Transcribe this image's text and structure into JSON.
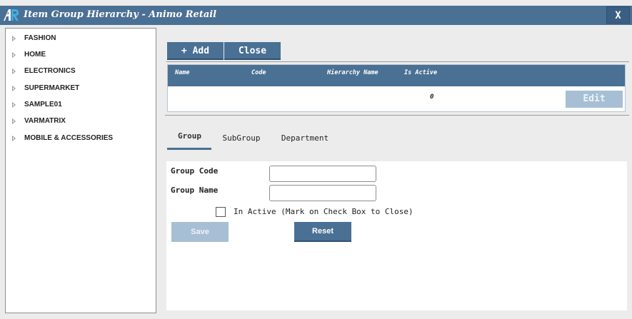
{
  "window": {
    "title": "Item Group Hierarchy - Animo Retail",
    "close_label": "X",
    "logo_icon": "ar-logo-icon",
    "accent_color": "#4a7094"
  },
  "tree": {
    "items": [
      {
        "label": "FASHION"
      },
      {
        "label": "HOME"
      },
      {
        "label": "ELECTRONICS"
      },
      {
        "label": "SUPERMARKET"
      },
      {
        "label": "SAMPLE01"
      },
      {
        "label": "VARMATRIX"
      },
      {
        "label": "MOBILE & ACCESSORIES"
      }
    ]
  },
  "toolbar": {
    "add_label": "+ Add",
    "close_label": "Close"
  },
  "grid": {
    "columns": [
      "Name",
      "Code",
      "Hierarchy Name",
      "Is Active"
    ],
    "rows": [
      {
        "name": "",
        "code": "",
        "hierarchy_name": "",
        "is_active": "0",
        "edit_label": "Edit"
      }
    ]
  },
  "tabs": [
    {
      "label": "Group",
      "active": true
    },
    {
      "label": "SubGroup",
      "active": false
    },
    {
      "label": "Department",
      "active": false
    }
  ],
  "form": {
    "group_code_label": "Group Code",
    "group_code_value": "",
    "group_name_label": "Group Name",
    "group_name_value": "",
    "inactive_label": "In Active (Mark on Check Box to Close)",
    "inactive_checked": false,
    "save_label": "Save",
    "reset_label": "Reset"
  }
}
